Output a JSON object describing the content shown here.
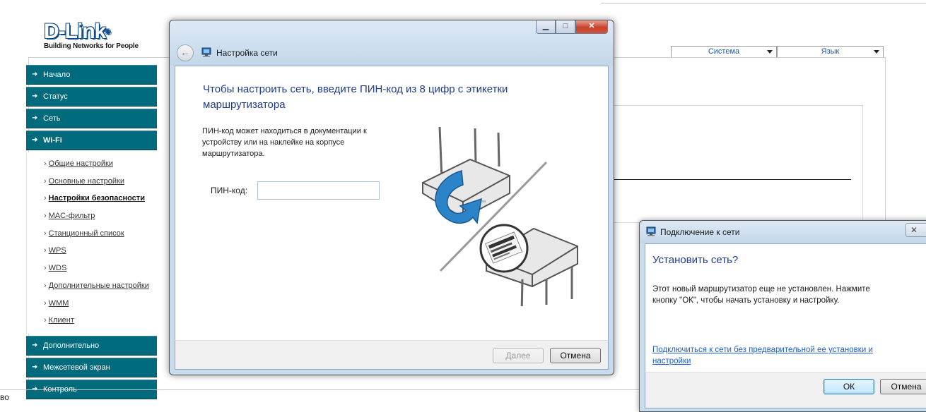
{
  "brand": {
    "name": "D-Link",
    "tagline": "Building Networks for People"
  },
  "top_selects": {
    "system": "Система",
    "language": "Язык"
  },
  "menu": {
    "items_top": [
      {
        "label": "Начало"
      },
      {
        "label": "Статус"
      },
      {
        "label": "Сеть"
      },
      {
        "label": "Wi-Fi"
      }
    ],
    "wifi_submenu": [
      {
        "label": "Общие настройки"
      },
      {
        "label": "Основные настройки"
      },
      {
        "label": "Настройки безопасности",
        "active": true
      },
      {
        "label": "MAC-фильтр"
      },
      {
        "label": "Станционный список"
      },
      {
        "label": "WPS"
      },
      {
        "label": "WDS"
      },
      {
        "label": "Дополнительные настройки"
      },
      {
        "label": "WMM"
      },
      {
        "label": "Клиент"
      }
    ],
    "items_bottom": [
      {
        "label": "Дополнительно"
      },
      {
        "label": "Межсетевой экран"
      },
      {
        "label": "Контроль"
      }
    ]
  },
  "footer": {
    "text": "во"
  },
  "network_setup_dialog": {
    "title": "Настройка сети",
    "heading": "Чтобы настроить сеть, введите ПИН-код из 8 цифр с этикетки маршрутизатора",
    "description": "ПИН-код может находиться в документации к устройству или на наклейке на корпусе маршрутизатора.",
    "pin_label": "ПИН-код:",
    "pin_value": "",
    "next_button": "Далее",
    "cancel_button": "Отмена"
  },
  "connect_dialog": {
    "title": "Подключение к сети",
    "heading": "Установить сеть?",
    "message": "Этот новый маршрутизатор еще не установлен. Нажмите кнопку \"ОК\", чтобы начать установку и настройку.",
    "link": "Подключиться к сети без предварительной ее установки и настройки",
    "ok_button": "ОК",
    "cancel_button": "Отмена"
  },
  "colors": {
    "menu_bg": "#006b7c",
    "heading_blue": "#1e3a8a",
    "link_blue": "#1f5fc4",
    "window_chrome": "#c9dcee",
    "close_red": "#c8412b"
  }
}
